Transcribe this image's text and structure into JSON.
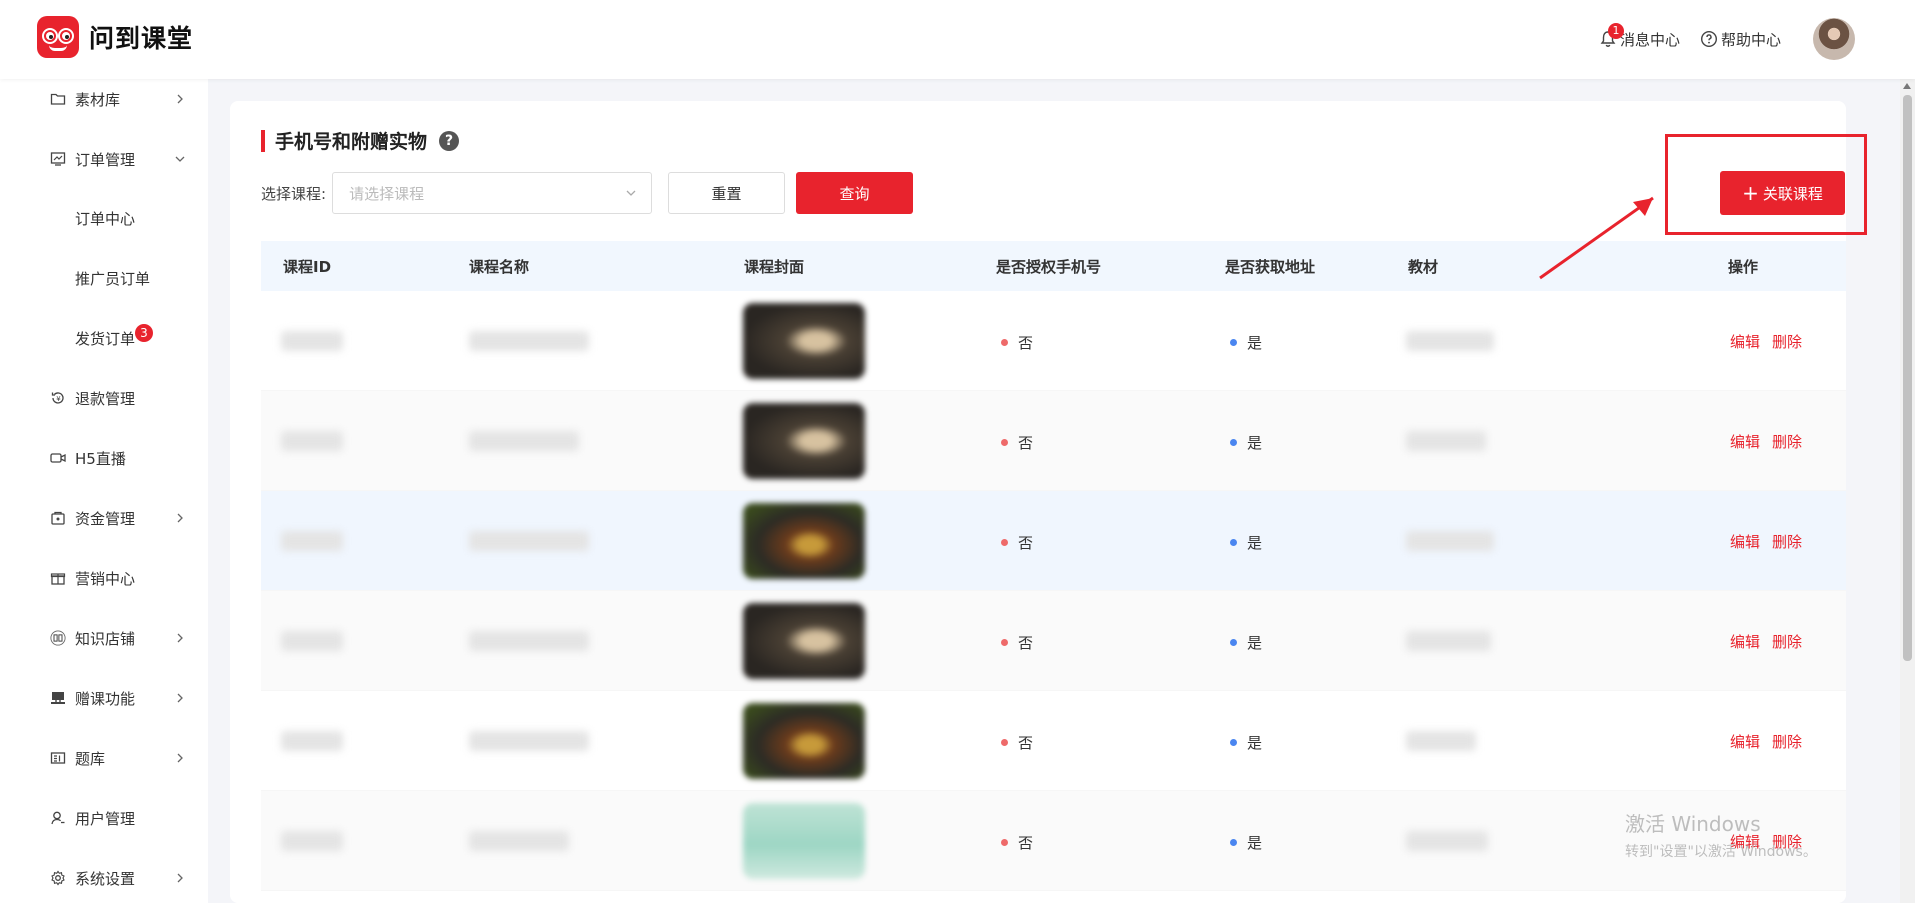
{
  "app": {
    "name": "问到课堂"
  },
  "header": {
    "messages_label": "消息中心",
    "messages_count": "1",
    "help_label": "帮助中心"
  },
  "sidebar": {
    "items": [
      {
        "label": "素材库",
        "icon": "folder-icon",
        "has_children": true
      },
      {
        "label": "订单管理",
        "icon": "order-icon",
        "has_children": true,
        "expanded": true
      },
      {
        "label": "订单中心",
        "sub": true
      },
      {
        "label": "推广员订单",
        "sub": true
      },
      {
        "label": "发货订单",
        "sub": true,
        "badge": "3"
      },
      {
        "label": "退款管理",
        "icon": "refund-icon"
      },
      {
        "label": "H5直播",
        "icon": "video-icon"
      },
      {
        "label": "资金管理",
        "icon": "wallet-icon",
        "has_children": true
      },
      {
        "label": "营销中心",
        "icon": "gift-icon"
      },
      {
        "label": "知识店铺",
        "icon": "book-icon",
        "has_children": true
      },
      {
        "label": "赠课功能",
        "icon": "gift-course-icon",
        "has_children": true
      },
      {
        "label": "题库",
        "icon": "question-bank-icon",
        "has_children": true
      },
      {
        "label": "用户管理",
        "icon": "user-icon"
      },
      {
        "label": "系统设置",
        "icon": "settings-icon",
        "has_children": true
      }
    ]
  },
  "page": {
    "title": "手机号和附赠实物",
    "help": "?",
    "filter_label": "选择课程:",
    "select_placeholder": "请选择课程",
    "reset_label": "重置",
    "query_label": "查询",
    "link_course_label": "关联课程",
    "link_course_plus": "+"
  },
  "table": {
    "columns": [
      "课程ID",
      "课程名称",
      "课程封面",
      "是否授权手机号",
      "是否获取地址",
      "教材",
      "操作"
    ],
    "rows": [
      {
        "auth_phone": "否",
        "get_address": "是",
        "edit": "编辑",
        "delete": "删除"
      },
      {
        "auth_phone": "否",
        "get_address": "是",
        "edit": "编辑",
        "delete": "删除"
      },
      {
        "auth_phone": "否",
        "get_address": "是",
        "edit": "编辑",
        "delete": "删除"
      },
      {
        "auth_phone": "否",
        "get_address": "是",
        "edit": "编辑",
        "delete": "删除"
      },
      {
        "auth_phone": "否",
        "get_address": "是",
        "edit": "编辑",
        "delete": "删除"
      },
      {
        "auth_phone": "否",
        "get_address": "是",
        "edit": "编辑",
        "delete": "删除"
      }
    ]
  },
  "watermark": {
    "line1": "激活 Windows",
    "line2": "转到\"设置\"以激活 Windows。"
  },
  "colors": {
    "accent": "#e8232d",
    "no_dot": "#ee6a6a",
    "yes_dot": "#4a86f0",
    "table_header_bg": "#f1f7fe"
  }
}
